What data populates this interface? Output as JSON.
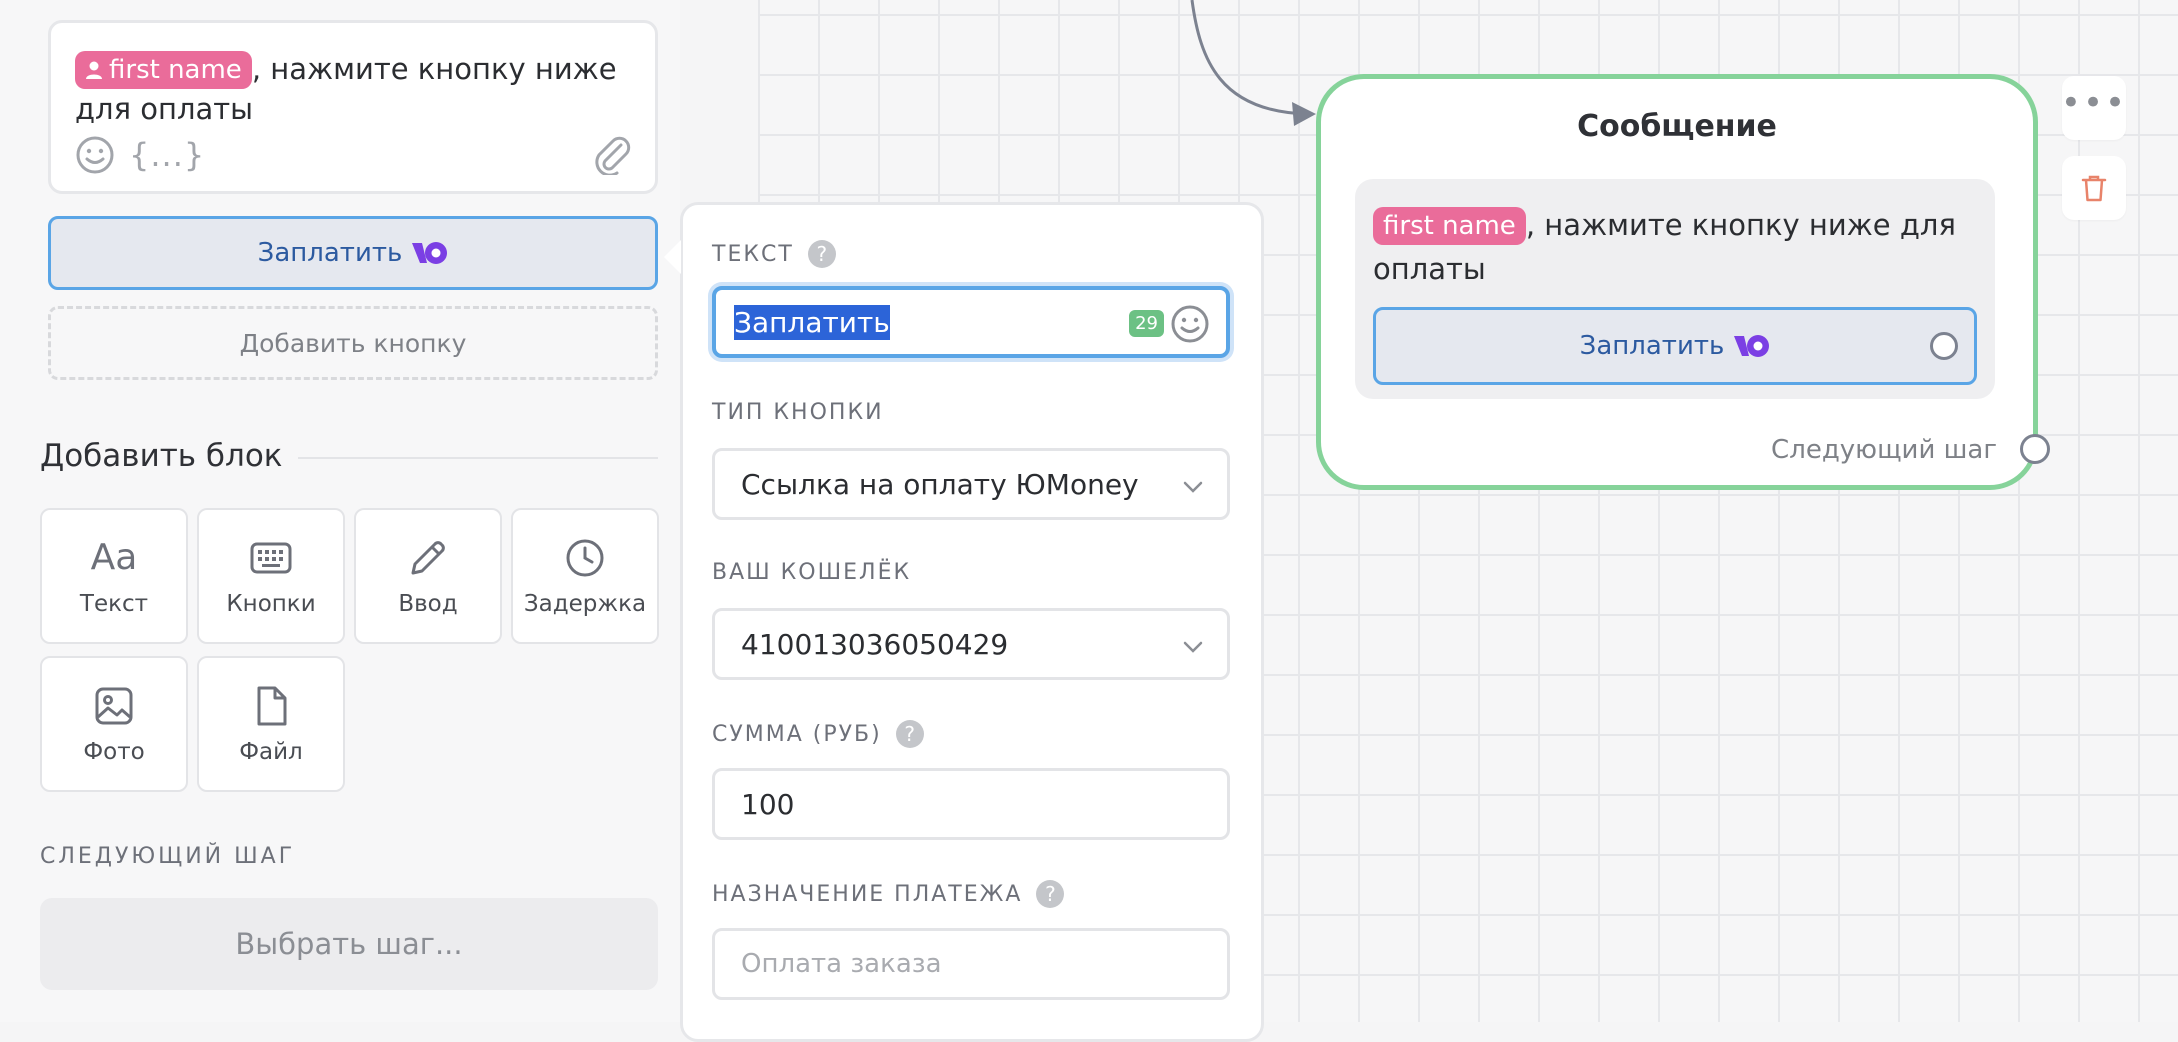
{
  "colors": {
    "accent_blue": "#5aa5e6",
    "variable_chip": "#ea6c9a",
    "node_border_green": "#86d39a",
    "counter_green": "#6cc184",
    "yoomoney_purple": "#7b3fe4",
    "trash_red": "#e8836a"
  },
  "editor": {
    "variable": "first name",
    "text": ", нажмите кнопку ниже для оплаты",
    "icons": [
      "emoji-icon",
      "variables-icon",
      "attach-icon"
    ],
    "variables_glyph": "{...}"
  },
  "buttons": {
    "pay_label": "Заплатить",
    "add_label": "Добавить кнопку"
  },
  "add_block": {
    "title": "Добавить блок",
    "items": [
      {
        "label": "Текст",
        "icon": "text-icon",
        "glyph": "Aa"
      },
      {
        "label": "Кнопки",
        "icon": "keyboard-icon"
      },
      {
        "label": "Ввод",
        "icon": "pencil-icon"
      },
      {
        "label": "Задержка",
        "icon": "clock-icon"
      },
      {
        "label": "Фото",
        "icon": "image-icon"
      },
      {
        "label": "Файл",
        "icon": "file-icon"
      }
    ]
  },
  "next_step": {
    "title": "СЛЕДУЮЩИЙ ШАГ",
    "choose": "Выбрать шаг..."
  },
  "popup": {
    "text_label": "ТЕКСТ",
    "text_value": "Заплатить",
    "counter": "29",
    "type_label": "ТИП КНОПКИ",
    "type_value": "Ссылка на оплату ЮMoney",
    "wallet_label": "ВАШ КОШЕЛЁК",
    "wallet_value": "410013036050429",
    "amount_label": "СУММА (РУБ)",
    "amount_value": "100",
    "purpose_label": "НАЗНАЧЕНИЕ ПЛАТЕЖА",
    "purpose_placeholder": "Оплата заказа",
    "help_glyph": "?"
  },
  "node": {
    "title": "Сообщение",
    "variable": "first name",
    "text": ", нажмите кнопку ниже для оплаты",
    "button_label": "Заплатить",
    "next_step": "Следующий шаг",
    "more_glyph": "•••"
  }
}
